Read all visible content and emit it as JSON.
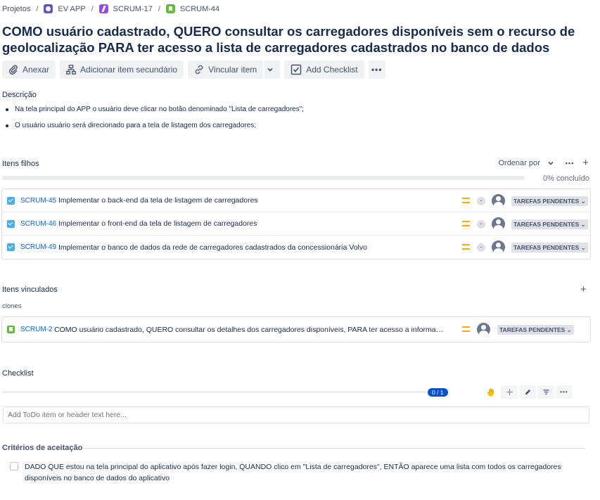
{
  "breadcrumb": {
    "items": [
      {
        "label": "Projetos",
        "icon": ""
      },
      {
        "label": "EV APP",
        "icon": "project-icon"
      },
      {
        "label": "SCRUM-17",
        "icon": "epic-icon"
      },
      {
        "label": "SCRUM-44",
        "icon": "story-icon"
      }
    ],
    "separator": "/"
  },
  "issue": {
    "title": "COMO usuário cadastrado, QUERO consultar os carregadores disponíveis sem o recurso de geolocalização PARA ter acesso a lista de carregadores cadastrados no banco de dados"
  },
  "toolbar": {
    "attach": "Anexar",
    "add_child": "Adicionar item secundário",
    "link": "Vincular item",
    "add_checklist": "Add Checklist",
    "more": "•••"
  },
  "description": {
    "label": "Descrição",
    "bullets": [
      "Na tela principal do APP o usuário deve clicar no botão denominado \"Lista de carregadores\";",
      "O usuário usuário será direcionado para a tela de listagem dos carregadores;"
    ]
  },
  "child_items": {
    "label": "Itens filhos",
    "sort_label": "Ordenar por",
    "progress_text": "0% concluído",
    "progress_value": 0,
    "rows": [
      {
        "key": "SCRUM-45",
        "summary": "Implementar o back-end da tela de listagem de carregadores",
        "priority_icon": "priority-medium-icon",
        "estimate": "-",
        "status": "TAREFAS PENDENTES"
      },
      {
        "key": "SCRUM-46",
        "summary": "Implementar o front-end da tela de listagem de carregadores",
        "priority_icon": "priority-medium-icon",
        "estimate": "-",
        "status": "TAREFAS PENDENTES"
      },
      {
        "key": "SCRUM-49",
        "summary": "Implementar o banco de dados da rede de carregadores cadastrados da concessionária Volvo",
        "priority_icon": "priority-medium-icon",
        "estimate": "-",
        "status": "TAREFAS PENDENTES"
      }
    ]
  },
  "linked_items": {
    "label": "Itens vinculados",
    "relation": "clones",
    "rows": [
      {
        "key": "SCRUM-2",
        "summary": "COMO usuário cadastrado, QUERO consultar os detalhes dos carregadores disponíveis, PARA ter acesso a informações",
        "status": "TAREFAS PENDENTES"
      }
    ]
  },
  "checklist": {
    "label": "Checklist",
    "progress_badge": "0 / 1",
    "progress_value": 0,
    "input_placeholder": "Add ToDo item or header text here..."
  },
  "acceptance": {
    "label": "Critérios de aceitação",
    "items": [
      {
        "text": "DADO QUE estou na tela principal do aplicativo após fazer login, QUANDO clico em \"Lista de carregadores\", ENTÃO aparece uma lista com todos os carregadores disponíveis no banco de dados do aplicativo",
        "checked": false
      }
    ]
  },
  "colors": {
    "link_blue": "#0c66e4",
    "priority_medium": "#ffab00",
    "story_green": "#63ba3c",
    "task_blue": "#4bade8",
    "epic_purple": "#904ee2",
    "badge_blue": "#0052cc"
  }
}
